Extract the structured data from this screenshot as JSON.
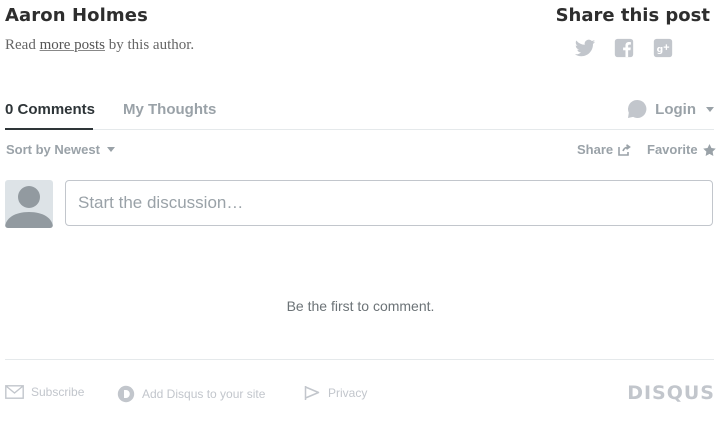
{
  "author": {
    "name": "Aaron Holmes",
    "read_prefix": "Read",
    "more_posts_link": "more posts",
    "read_suffix": "by this author."
  },
  "share": {
    "title": "Share this post",
    "icons": [
      "twitter-icon",
      "facebook-icon",
      "google-plus-icon"
    ]
  },
  "tabs": [
    {
      "label": "0 Comments",
      "active": true
    },
    {
      "label": "My Thoughts",
      "active": false
    }
  ],
  "login": {
    "label": "Login"
  },
  "toolbar": {
    "sort_label": "Sort by Newest",
    "share_label": "Share",
    "favorite_label": "Favorite"
  },
  "composer": {
    "placeholder": "Start the discussion…"
  },
  "empty_message": "Be the first to comment.",
  "footer": {
    "subscribe_label": "Subscribe",
    "add_disqus_label": "Add Disqus to your site",
    "privacy_label": "Privacy",
    "logo_text": "DISQUS"
  },
  "colors": {
    "muted": "#9aa2a8",
    "text": "#2e3538",
    "border": "#c2c6cc"
  }
}
